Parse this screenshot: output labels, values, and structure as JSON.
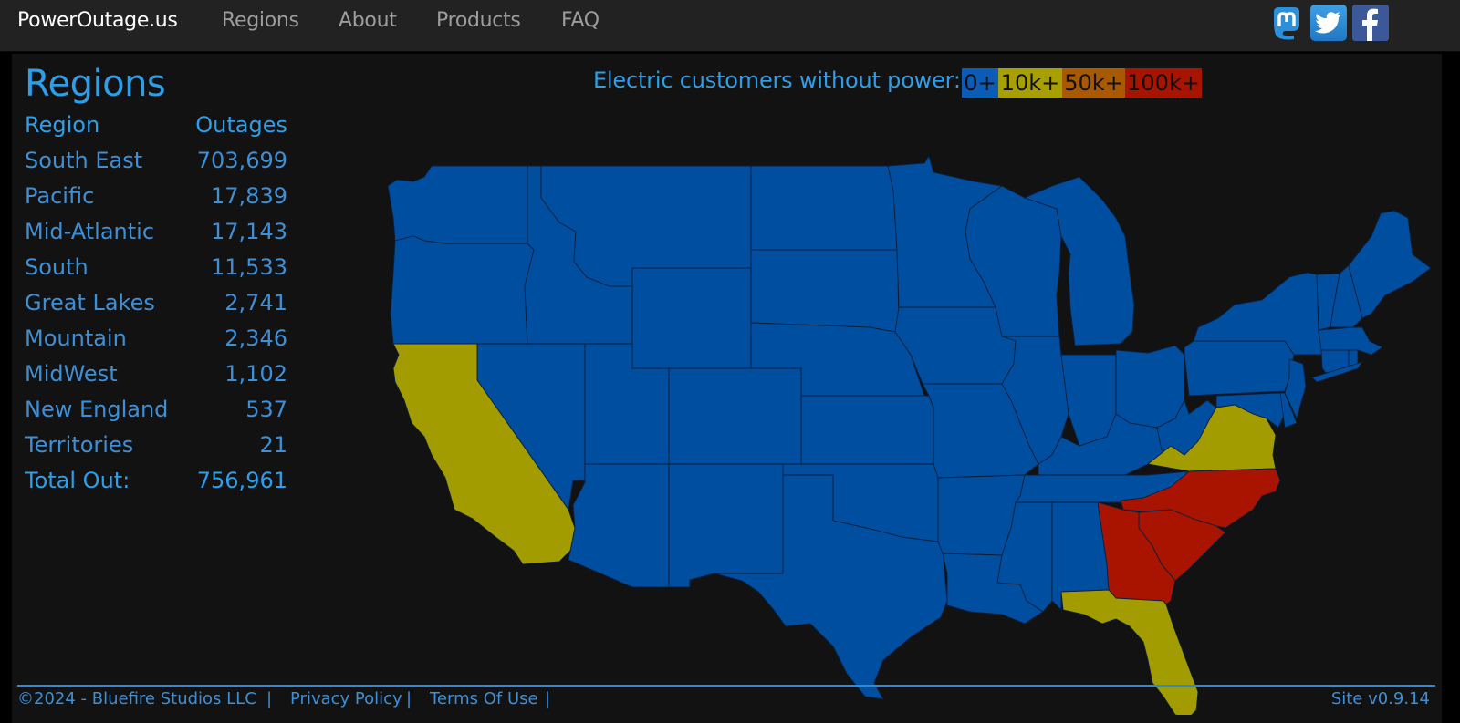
{
  "navbar": {
    "brand": "PowerOutage.us",
    "links": [
      "Regions",
      "About",
      "Products",
      "FAQ"
    ],
    "social": [
      {
        "name": "mastodon-icon",
        "color": "#2b90d9"
      },
      {
        "name": "twitter-icon",
        "color": "#2a8fd8"
      },
      {
        "name": "facebook-icon",
        "color": "#3b5998"
      }
    ]
  },
  "main": {
    "title": "Regions",
    "table": {
      "headers": [
        "Region",
        "Outages"
      ],
      "rows": [
        {
          "region": "South East",
          "outages": "703,699"
        },
        {
          "region": "Pacific",
          "outages": "17,839"
        },
        {
          "region": "Mid-Atlantic",
          "outages": "17,143"
        },
        {
          "region": "South",
          "outages": "11,533"
        },
        {
          "region": "Great Lakes",
          "outages": "2,741"
        },
        {
          "region": "Mountain",
          "outages": "2,346"
        },
        {
          "region": "MidWest",
          "outages": "1,102"
        },
        {
          "region": "New England",
          "outages": "537"
        },
        {
          "region": "Territories",
          "outages": "21"
        }
      ],
      "total": {
        "label": "Total Out:",
        "value": "756,961"
      }
    },
    "legend": {
      "label": "Electric customers without power:",
      "levels": [
        {
          "label": "0+",
          "color": "#0a5cb8"
        },
        {
          "label": "10k+",
          "color": "#a8a000"
        },
        {
          "label": "50k+",
          "color": "#a95a00"
        },
        {
          "label": "100k+",
          "color": "#a81400"
        }
      ]
    },
    "map": {
      "default_color": "#004ea0",
      "highlighted_states": [
        {
          "state": "California",
          "level": "10k+",
          "color": "#a39c00"
        },
        {
          "state": "Virginia",
          "level": "10k+",
          "color": "#a39c00"
        },
        {
          "state": "Florida",
          "level": "10k+",
          "color": "#a39c00"
        },
        {
          "state": "North Carolina",
          "level": "100k+",
          "color": "#a81400"
        },
        {
          "state": "South Carolina",
          "level": "100k+",
          "color": "#a81400"
        },
        {
          "state": "Georgia",
          "level": "100k+",
          "color": "#a81400"
        }
      ]
    }
  },
  "footer": {
    "copyright": "©2024 - Bluefire Studios LLC",
    "sep": "|",
    "privacy": "Privacy Policy",
    "terms": "Terms Of Use",
    "version": "Site v0.9.14"
  }
}
